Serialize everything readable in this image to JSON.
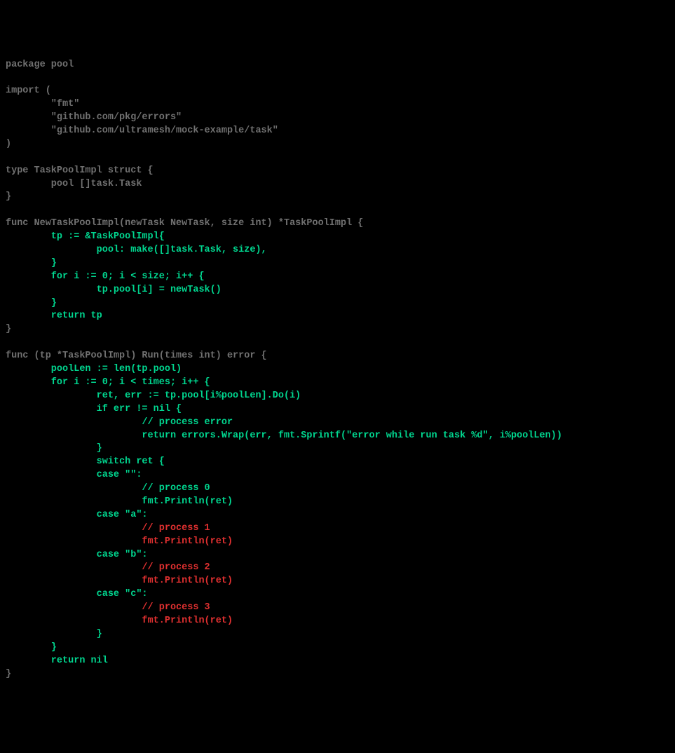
{
  "code": [
    {
      "segments": [
        {
          "c": "gray",
          "t": "package pool"
        }
      ]
    },
    {
      "segments": [
        {
          "c": "gray",
          "t": ""
        }
      ]
    },
    {
      "segments": [
        {
          "c": "gray",
          "t": "import ("
        }
      ]
    },
    {
      "segments": [
        {
          "c": "gray",
          "t": "        \"fmt\""
        }
      ]
    },
    {
      "segments": [
        {
          "c": "gray",
          "t": "        \"github.com/pkg/errors\""
        }
      ]
    },
    {
      "segments": [
        {
          "c": "gray",
          "t": "        \"github.com/ultramesh/mock-example/task\""
        }
      ]
    },
    {
      "segments": [
        {
          "c": "gray",
          "t": ")"
        }
      ]
    },
    {
      "segments": [
        {
          "c": "gray",
          "t": ""
        }
      ]
    },
    {
      "segments": [
        {
          "c": "gray",
          "t": "type TaskPoolImpl struct {"
        }
      ]
    },
    {
      "segments": [
        {
          "c": "gray",
          "t": "        pool []task.Task"
        }
      ]
    },
    {
      "segments": [
        {
          "c": "gray",
          "t": "}"
        }
      ]
    },
    {
      "segments": [
        {
          "c": "gray",
          "t": ""
        }
      ]
    },
    {
      "segments": [
        {
          "c": "gray",
          "t": "func NewTaskPoolImpl(newTask NewTask, size int) *TaskPoolImpl {"
        }
      ]
    },
    {
      "segments": [
        {
          "c": "green",
          "t": "        tp := &TaskPoolImpl{"
        }
      ]
    },
    {
      "segments": [
        {
          "c": "green",
          "t": "                pool: make([]task.Task, size),"
        }
      ]
    },
    {
      "segments": [
        {
          "c": "green",
          "t": "        }"
        }
      ]
    },
    {
      "segments": [
        {
          "c": "green",
          "t": "        for i := 0; i < size; i++ {"
        }
      ]
    },
    {
      "segments": [
        {
          "c": "green",
          "t": "                tp.pool[i] = newTask()"
        }
      ]
    },
    {
      "segments": [
        {
          "c": "green",
          "t": "        }"
        }
      ]
    },
    {
      "segments": [
        {
          "c": "green",
          "t": "        return tp"
        }
      ]
    },
    {
      "segments": [
        {
          "c": "gray",
          "t": "}"
        }
      ]
    },
    {
      "segments": [
        {
          "c": "gray",
          "t": ""
        }
      ]
    },
    {
      "segments": [
        {
          "c": "gray",
          "t": "func (tp *TaskPoolImpl) Run(times int) error {"
        }
      ]
    },
    {
      "segments": [
        {
          "c": "green",
          "t": "        poolLen := len(tp.pool)"
        }
      ]
    },
    {
      "segments": [
        {
          "c": "green",
          "t": "        for i := 0; i < times; i++ {"
        }
      ]
    },
    {
      "segments": [
        {
          "c": "green",
          "t": "                ret, err := tp.pool[i%poolLen].Do(i)"
        }
      ]
    },
    {
      "segments": [
        {
          "c": "green",
          "t": "                if err != nil {"
        }
      ]
    },
    {
      "segments": [
        {
          "c": "green",
          "t": "                        // process error"
        }
      ]
    },
    {
      "segments": [
        {
          "c": "green",
          "t": "                        return errors.Wrap(err, fmt.Sprintf(\"error while run task %d\", i%poolLen))"
        }
      ]
    },
    {
      "segments": [
        {
          "c": "green",
          "t": "                }"
        }
      ]
    },
    {
      "segments": [
        {
          "c": "green",
          "t": "                switch ret {"
        }
      ]
    },
    {
      "segments": [
        {
          "c": "green",
          "t": "                case \"\":"
        }
      ]
    },
    {
      "segments": [
        {
          "c": "green",
          "t": "                        // process 0"
        }
      ]
    },
    {
      "segments": [
        {
          "c": "green",
          "t": "                        fmt.Println(ret)"
        }
      ]
    },
    {
      "segments": [
        {
          "c": "green",
          "t": "                case \"a\":"
        }
      ]
    },
    {
      "segments": [
        {
          "c": "red",
          "t": "                        // process 1"
        }
      ]
    },
    {
      "segments": [
        {
          "c": "red",
          "t": "                        fmt.Println(ret)"
        }
      ]
    },
    {
      "segments": [
        {
          "c": "green",
          "t": "                case \"b\":"
        }
      ]
    },
    {
      "segments": [
        {
          "c": "red",
          "t": "                        // process 2"
        }
      ]
    },
    {
      "segments": [
        {
          "c": "red",
          "t": "                        fmt.Println(ret)"
        }
      ]
    },
    {
      "segments": [
        {
          "c": "green",
          "t": "                case \"c\":"
        }
      ]
    },
    {
      "segments": [
        {
          "c": "red",
          "t": "                        // process 3"
        }
      ]
    },
    {
      "segments": [
        {
          "c": "red",
          "t": "                        fmt.Println(ret)"
        }
      ]
    },
    {
      "segments": [
        {
          "c": "green",
          "t": "                }"
        }
      ]
    },
    {
      "segments": [
        {
          "c": "green",
          "t": "        }"
        }
      ]
    },
    {
      "segments": [
        {
          "c": "green",
          "t": "        return nil"
        }
      ]
    },
    {
      "segments": [
        {
          "c": "gray",
          "t": "}"
        }
      ]
    }
  ]
}
